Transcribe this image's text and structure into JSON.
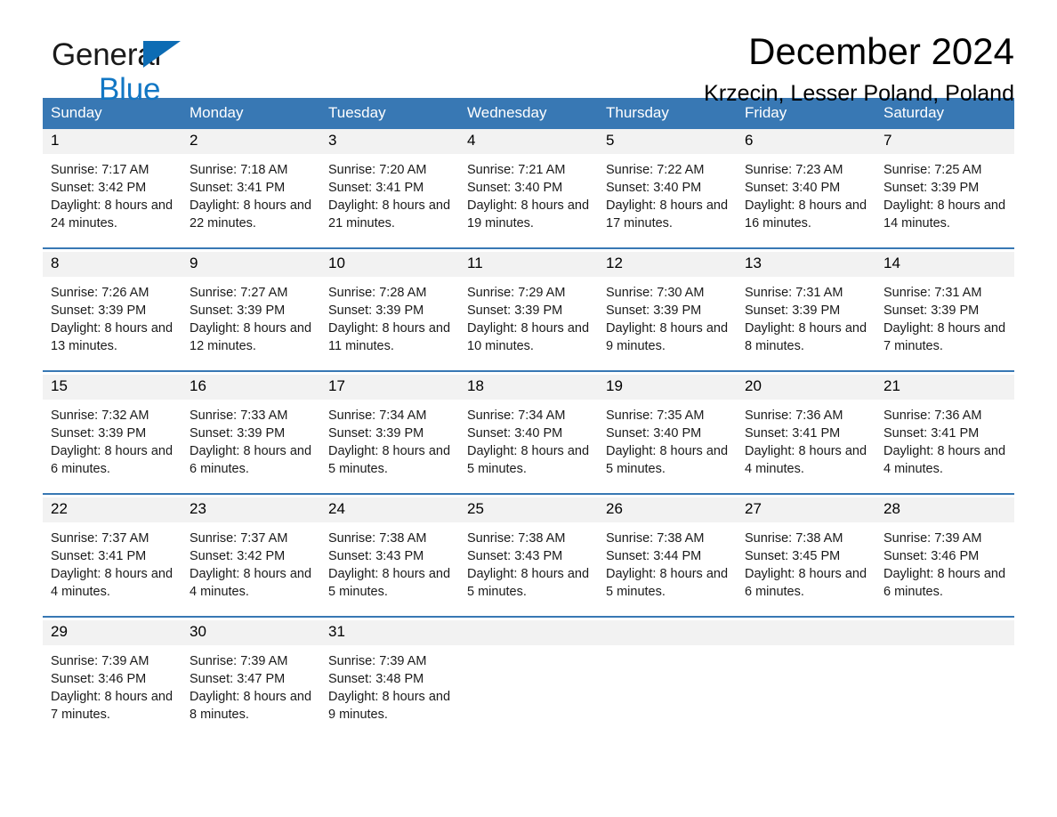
{
  "brand": {
    "name_part1": "General",
    "name_part2": "Blue",
    "accent_color": "#1277c4",
    "triangle_color": "#0d6cb4"
  },
  "header": {
    "month_title": "December 2024",
    "location": "Krzecin, Lesser Poland, Poland"
  },
  "calendar": {
    "header_color": "#3878b4",
    "daynum_band_color": "#f2f2f2",
    "weekdays": [
      "Sunday",
      "Monday",
      "Tuesday",
      "Wednesday",
      "Thursday",
      "Friday",
      "Saturday"
    ],
    "weeks": [
      [
        {
          "day": "1",
          "sunrise": "Sunrise: 7:17 AM",
          "sunset": "Sunset: 3:42 PM",
          "daylight": "Daylight: 8 hours and 24 minutes."
        },
        {
          "day": "2",
          "sunrise": "Sunrise: 7:18 AM",
          "sunset": "Sunset: 3:41 PM",
          "daylight": "Daylight: 8 hours and 22 minutes."
        },
        {
          "day": "3",
          "sunrise": "Sunrise: 7:20 AM",
          "sunset": "Sunset: 3:41 PM",
          "daylight": "Daylight: 8 hours and 21 minutes."
        },
        {
          "day": "4",
          "sunrise": "Sunrise: 7:21 AM",
          "sunset": "Sunset: 3:40 PM",
          "daylight": "Daylight: 8 hours and 19 minutes."
        },
        {
          "day": "5",
          "sunrise": "Sunrise: 7:22 AM",
          "sunset": "Sunset: 3:40 PM",
          "daylight": "Daylight: 8 hours and 17 minutes."
        },
        {
          "day": "6",
          "sunrise": "Sunrise: 7:23 AM",
          "sunset": "Sunset: 3:40 PM",
          "daylight": "Daylight: 8 hours and 16 minutes."
        },
        {
          "day": "7",
          "sunrise": "Sunrise: 7:25 AM",
          "sunset": "Sunset: 3:39 PM",
          "daylight": "Daylight: 8 hours and 14 minutes."
        }
      ],
      [
        {
          "day": "8",
          "sunrise": "Sunrise: 7:26 AM",
          "sunset": "Sunset: 3:39 PM",
          "daylight": "Daylight: 8 hours and 13 minutes."
        },
        {
          "day": "9",
          "sunrise": "Sunrise: 7:27 AM",
          "sunset": "Sunset: 3:39 PM",
          "daylight": "Daylight: 8 hours and 12 minutes."
        },
        {
          "day": "10",
          "sunrise": "Sunrise: 7:28 AM",
          "sunset": "Sunset: 3:39 PM",
          "daylight": "Daylight: 8 hours and 11 minutes."
        },
        {
          "day": "11",
          "sunrise": "Sunrise: 7:29 AM",
          "sunset": "Sunset: 3:39 PM",
          "daylight": "Daylight: 8 hours and 10 minutes."
        },
        {
          "day": "12",
          "sunrise": "Sunrise: 7:30 AM",
          "sunset": "Sunset: 3:39 PM",
          "daylight": "Daylight: 8 hours and 9 minutes."
        },
        {
          "day": "13",
          "sunrise": "Sunrise: 7:31 AM",
          "sunset": "Sunset: 3:39 PM",
          "daylight": "Daylight: 8 hours and 8 minutes."
        },
        {
          "day": "14",
          "sunrise": "Sunrise: 7:31 AM",
          "sunset": "Sunset: 3:39 PM",
          "daylight": "Daylight: 8 hours and 7 minutes."
        }
      ],
      [
        {
          "day": "15",
          "sunrise": "Sunrise: 7:32 AM",
          "sunset": "Sunset: 3:39 PM",
          "daylight": "Daylight: 8 hours and 6 minutes."
        },
        {
          "day": "16",
          "sunrise": "Sunrise: 7:33 AM",
          "sunset": "Sunset: 3:39 PM",
          "daylight": "Daylight: 8 hours and 6 minutes."
        },
        {
          "day": "17",
          "sunrise": "Sunrise: 7:34 AM",
          "sunset": "Sunset: 3:39 PM",
          "daylight": "Daylight: 8 hours and 5 minutes."
        },
        {
          "day": "18",
          "sunrise": "Sunrise: 7:34 AM",
          "sunset": "Sunset: 3:40 PM",
          "daylight": "Daylight: 8 hours and 5 minutes."
        },
        {
          "day": "19",
          "sunrise": "Sunrise: 7:35 AM",
          "sunset": "Sunset: 3:40 PM",
          "daylight": "Daylight: 8 hours and 5 minutes."
        },
        {
          "day": "20",
          "sunrise": "Sunrise: 7:36 AM",
          "sunset": "Sunset: 3:41 PM",
          "daylight": "Daylight: 8 hours and 4 minutes."
        },
        {
          "day": "21",
          "sunrise": "Sunrise: 7:36 AM",
          "sunset": "Sunset: 3:41 PM",
          "daylight": "Daylight: 8 hours and 4 minutes."
        }
      ],
      [
        {
          "day": "22",
          "sunrise": "Sunrise: 7:37 AM",
          "sunset": "Sunset: 3:41 PM",
          "daylight": "Daylight: 8 hours and 4 minutes."
        },
        {
          "day": "23",
          "sunrise": "Sunrise: 7:37 AM",
          "sunset": "Sunset: 3:42 PM",
          "daylight": "Daylight: 8 hours and 4 minutes."
        },
        {
          "day": "24",
          "sunrise": "Sunrise: 7:38 AM",
          "sunset": "Sunset: 3:43 PM",
          "daylight": "Daylight: 8 hours and 5 minutes."
        },
        {
          "day": "25",
          "sunrise": "Sunrise: 7:38 AM",
          "sunset": "Sunset: 3:43 PM",
          "daylight": "Daylight: 8 hours and 5 minutes."
        },
        {
          "day": "26",
          "sunrise": "Sunrise: 7:38 AM",
          "sunset": "Sunset: 3:44 PM",
          "daylight": "Daylight: 8 hours and 5 minutes."
        },
        {
          "day": "27",
          "sunrise": "Sunrise: 7:38 AM",
          "sunset": "Sunset: 3:45 PM",
          "daylight": "Daylight: 8 hours and 6 minutes."
        },
        {
          "day": "28",
          "sunrise": "Sunrise: 7:39 AM",
          "sunset": "Sunset: 3:46 PM",
          "daylight": "Daylight: 8 hours and 6 minutes."
        }
      ],
      [
        {
          "day": "29",
          "sunrise": "Sunrise: 7:39 AM",
          "sunset": "Sunset: 3:46 PM",
          "daylight": "Daylight: 8 hours and 7 minutes."
        },
        {
          "day": "30",
          "sunrise": "Sunrise: 7:39 AM",
          "sunset": "Sunset: 3:47 PM",
          "daylight": "Daylight: 8 hours and 8 minutes."
        },
        {
          "day": "31",
          "sunrise": "Sunrise: 7:39 AM",
          "sunset": "Sunset: 3:48 PM",
          "daylight": "Daylight: 8 hours and 9 minutes."
        },
        {
          "day": "",
          "sunrise": "",
          "sunset": "",
          "daylight": ""
        },
        {
          "day": "",
          "sunrise": "",
          "sunset": "",
          "daylight": ""
        },
        {
          "day": "",
          "sunrise": "",
          "sunset": "",
          "daylight": ""
        },
        {
          "day": "",
          "sunrise": "",
          "sunset": "",
          "daylight": ""
        }
      ]
    ]
  }
}
